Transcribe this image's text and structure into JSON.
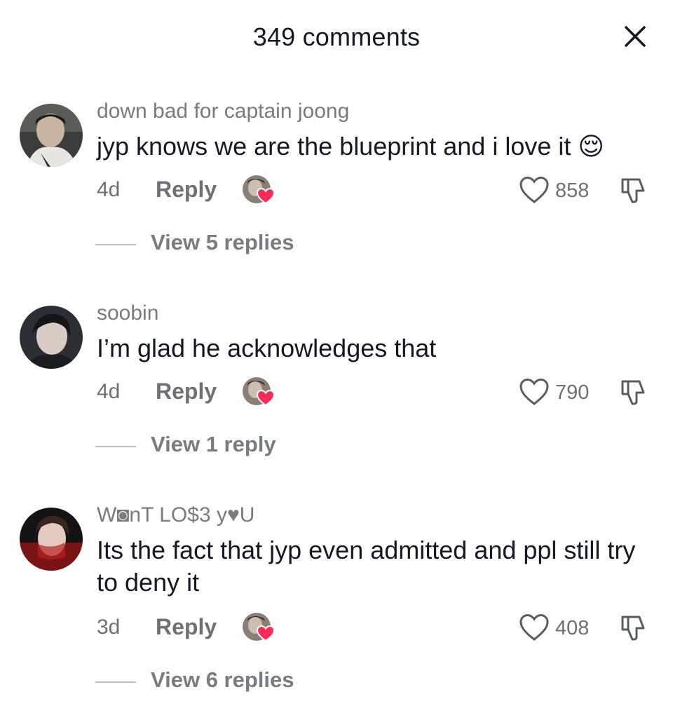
{
  "header": {
    "title": "349 comments"
  },
  "comments": [
    {
      "username": "down bad for captain joong",
      "text": "jyp knows we are the blueprint and i love it 😌",
      "time": "4d",
      "reply_label": "Reply",
      "likes": "858",
      "view_replies": "View 5 replies"
    },
    {
      "username": "soobin",
      "text": "I’m glad he acknowledges that",
      "time": "4d",
      "reply_label": "Reply",
      "likes": "790",
      "view_replies": "View 1 reply"
    },
    {
      "username": "W◙nT LO$3 y♥U",
      "text": "Its the fact that jyp even admitted and ppl still try to deny it",
      "time": "3d",
      "reply_label": "Reply",
      "likes": "408",
      "view_replies": "View 6 replies"
    }
  ],
  "icons": {
    "close": "close-icon",
    "like": "heart-outline-icon",
    "dislike": "thumbs-down-icon",
    "creator_liked": "creator-heart-icon"
  },
  "colors": {
    "heart_accent": "#fe2c55",
    "muted_text": "#6f7075"
  }
}
